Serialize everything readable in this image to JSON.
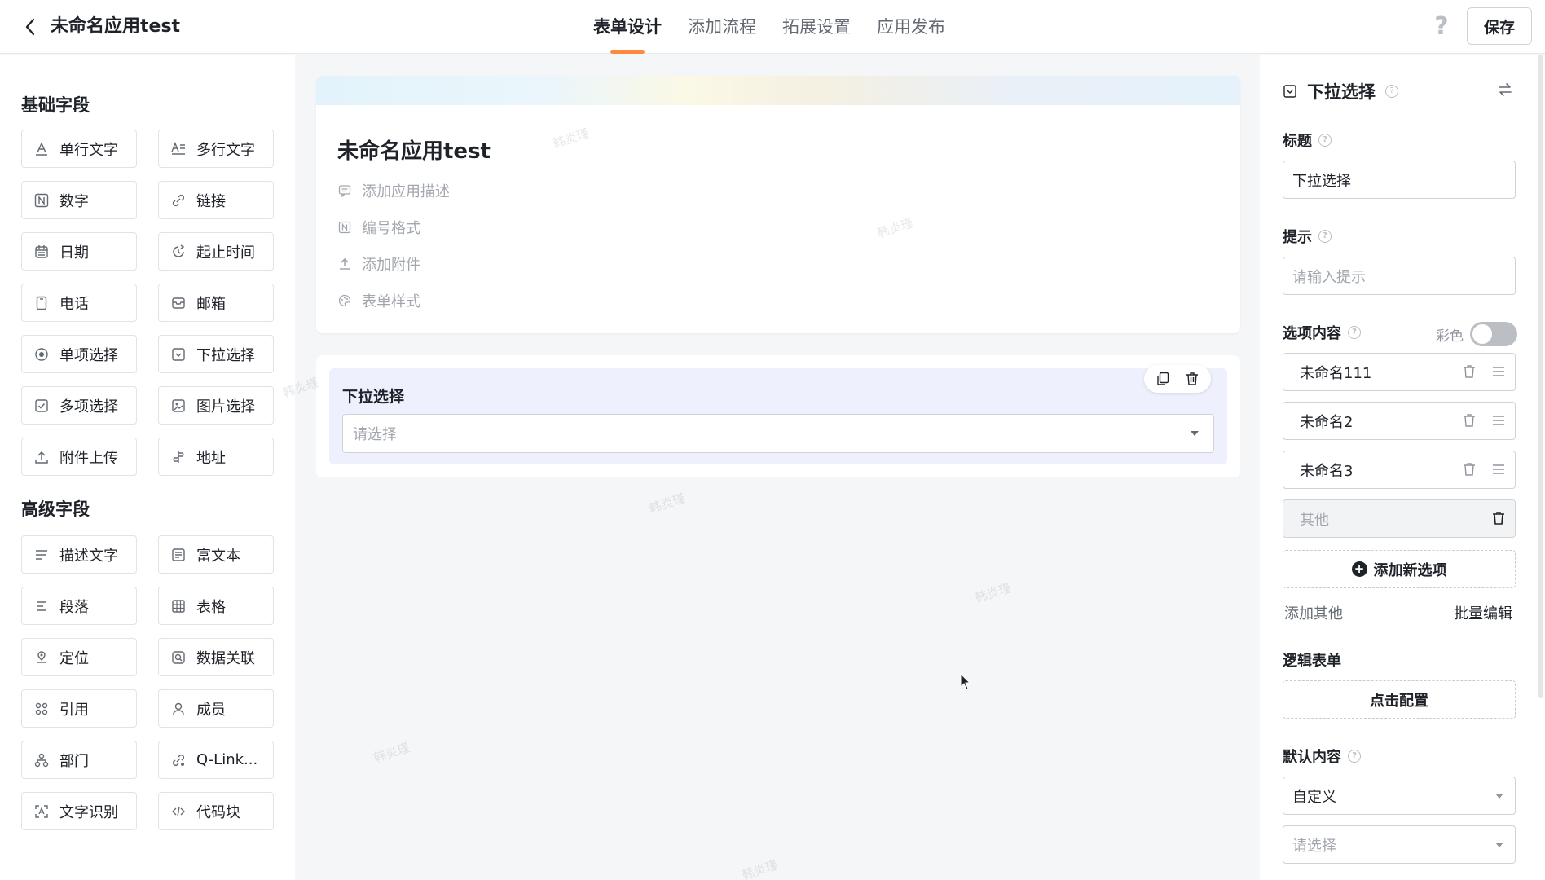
{
  "header": {
    "back_icon": "chevron-left-icon",
    "app_title": "未命名应用test",
    "tabs": [
      {
        "label": "表单设计",
        "active": true
      },
      {
        "label": "添加流程",
        "active": false
      },
      {
        "label": "拓展设置",
        "active": false
      },
      {
        "label": "应用发布",
        "active": false
      }
    ],
    "help_icon": "?",
    "save_label": "保存"
  },
  "left_panel": {
    "basic_title": "基础字段",
    "basic_fields": [
      {
        "label": "单行文字",
        "icon": "A"
      },
      {
        "label": "多行文字",
        "icon": "A≡"
      },
      {
        "label": "数字",
        "icon": "N"
      },
      {
        "label": "链接",
        "icon": "link"
      },
      {
        "label": "日期",
        "icon": "calendar"
      },
      {
        "label": "起止时间",
        "icon": "clock"
      },
      {
        "label": "电话",
        "icon": "phone"
      },
      {
        "label": "邮箱",
        "icon": "mail"
      },
      {
        "label": "单项选择",
        "icon": "radio"
      },
      {
        "label": "下拉选择",
        "icon": "select"
      },
      {
        "label": "多项选择",
        "icon": "checkbox"
      },
      {
        "label": "图片选择",
        "icon": "image"
      },
      {
        "label": "附件上传",
        "icon": "upload"
      },
      {
        "label": "地址",
        "icon": "address"
      }
    ],
    "advanced_title": "高级字段",
    "advanced_fields": [
      {
        "label": "描述文字",
        "icon": "lines"
      },
      {
        "label": "富文本",
        "icon": "doc"
      },
      {
        "label": "段落",
        "icon": "paragraph"
      },
      {
        "label": "表格",
        "icon": "table"
      },
      {
        "label": "定位",
        "icon": "location"
      },
      {
        "label": "数据关联",
        "icon": "link-data"
      },
      {
        "label": "引用",
        "icon": "reference"
      },
      {
        "label": "成员",
        "icon": "user"
      },
      {
        "label": "部门",
        "icon": "department"
      },
      {
        "label": "Q-Link...",
        "icon": "qlink"
      },
      {
        "label": "文字识别",
        "icon": "ocr"
      },
      {
        "label": "代码块",
        "icon": "code"
      }
    ]
  },
  "canvas": {
    "form_title": "未命名应用test",
    "meta_items": [
      {
        "label": "添加应用描述",
        "icon": "comment-icon"
      },
      {
        "label": "编号格式",
        "icon": "number-icon"
      },
      {
        "label": "添加附件",
        "icon": "upload-icon"
      },
      {
        "label": "表单样式",
        "icon": "palette-icon"
      }
    ],
    "field": {
      "label": "下拉选择",
      "placeholder": "请选择"
    },
    "watermark": "韩炎瑾"
  },
  "right_panel": {
    "component_title": "下拉选择",
    "title_label": "标题",
    "title_value": "下拉选择",
    "hint_label": "提示",
    "hint_placeholder": "请输入提示",
    "options_label": "选项内容",
    "color_label": "彩色",
    "color_enabled": false,
    "options": [
      "未命名111",
      "未命名2",
      "未命名3"
    ],
    "other_option": "其他",
    "add_option": "添加新选项",
    "add_other": "添加其他",
    "batch_edit": "批量编辑",
    "logic_label": "逻辑表单",
    "logic_button": "点击配置",
    "default_label": "默认内容",
    "default_mode": "自定义",
    "default_placeholder": "请选择"
  },
  "colors": {
    "accent": "#ff8a3d",
    "selected_field_bg": "#eef1fd",
    "text_primary": "#1f2329",
    "text_secondary": "#646a73"
  }
}
